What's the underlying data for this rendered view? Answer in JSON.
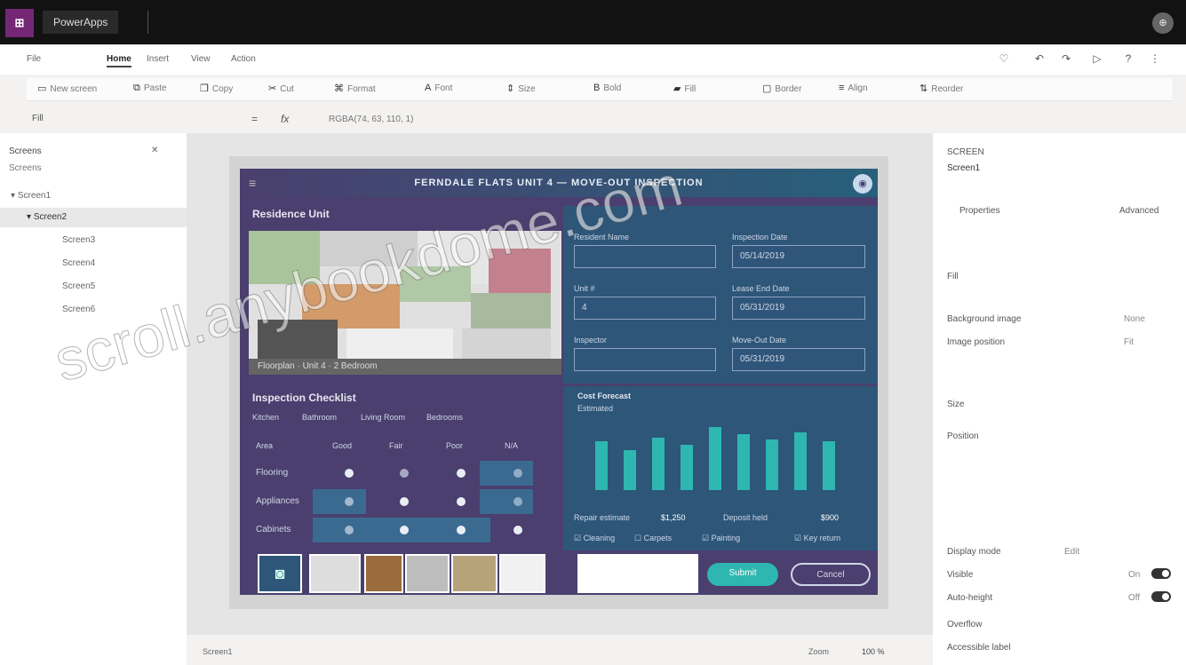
{
  "app": {
    "name": "PowerApps"
  },
  "titlebar": {
    "avatar_initial": "⊕"
  },
  "menubar": {
    "items": [
      "File",
      "Home",
      "Insert",
      "View",
      "Action"
    ],
    "active": "Home"
  },
  "ribbon": {
    "items": [
      {
        "icon": "new-screen-icon",
        "label": "New screen"
      },
      {
        "icon": "paste-icon",
        "label": "Paste"
      },
      {
        "icon": "copy-icon",
        "label": "Copy"
      },
      {
        "icon": "cut-icon",
        "label": "Cut"
      },
      {
        "icon": "format-painter-icon",
        "label": "Format"
      },
      {
        "icon": "font-icon",
        "label": "Font"
      },
      {
        "icon": "font-size-icon",
        "label": "Size"
      },
      {
        "icon": "bold-icon",
        "label": "Bold"
      },
      {
        "icon": "fill-icon",
        "label": "Fill"
      },
      {
        "icon": "border-icon",
        "label": "Border"
      },
      {
        "icon": "align-icon",
        "label": "Align"
      },
      {
        "icon": "reorder-icon",
        "label": "Reorder"
      }
    ]
  },
  "formula": {
    "property": "Fill",
    "eq": "=",
    "fx": "fx",
    "value": "RGBA(74, 63, 110, 1)"
  },
  "treeview": {
    "title": "Screens",
    "tab": "Screens",
    "items": [
      "Screen1",
      "Screen2",
      "Screen3",
      "Screen4",
      "Screen5",
      "Screen6"
    ]
  },
  "phone_app": {
    "header_title": "FERNDALE FLATS UNIT 4 — MOVE-OUT INSPECTION",
    "residence_title": "Residence Unit",
    "plan_caption": "Floorplan · Unit 4 · 2 Bedroom",
    "fields": [
      {
        "label": "Resident Name",
        "value": ""
      },
      {
        "label": "Inspection Date",
        "value": "05/14/2019"
      },
      {
        "label": "Unit #",
        "value": "4"
      },
      {
        "label": "Lease End Date",
        "value": "05/31/2019"
      },
      {
        "label": "Inspector",
        "value": ""
      },
      {
        "label": "Move-Out Date",
        "value": "05/31/2019"
      }
    ],
    "checklist_title": "Inspection Checklist",
    "checklist_tabs": [
      "Kitchen",
      "Bathroom",
      "Living Room",
      "Bedrooms"
    ],
    "checklist_columns": [
      "Area",
      "Good",
      "Fair",
      "Poor",
      "N/A"
    ],
    "checklist_rows": [
      "Flooring",
      "Appliances",
      "Cabinets"
    ],
    "chart_title": "Cost Forecast",
    "chart_subtitle": "Estimated",
    "repair_label": "Repair estimate",
    "repair_value": "$1,250",
    "deposit_label": "Deposit held",
    "deposit_value": "$900",
    "checkboxes": [
      "Cleaning",
      "Carpets",
      "Painting",
      "Key return"
    ],
    "submit": "Submit",
    "cancel": "Cancel"
  },
  "props": {
    "title": "SCREEN",
    "name": "Screen1",
    "tabs": [
      "Properties",
      "Advanced"
    ],
    "rows": [
      {
        "label": "Fill",
        "value": ""
      },
      {
        "label": "Background image",
        "value": "None"
      },
      {
        "label": "Image position",
        "value": "Fit"
      },
      {
        "label": "Size",
        "value": ""
      },
      {
        "label": "Position",
        "value": ""
      },
      {
        "label": "Visible",
        "value": "On"
      },
      {
        "label": "Auto-height",
        "value": "Off"
      },
      {
        "label": "Display mode",
        "value": "Edit"
      },
      {
        "label": "Overflow",
        "value": ""
      },
      {
        "label": "Accessible label",
        "value": ""
      }
    ]
  },
  "footer": {
    "screen": "Screen1",
    "zoom": "100 %",
    "zoom_label": "Zoom"
  },
  "watermark": "scroll.anybookdome.com",
  "colors": {
    "brand": "#742774",
    "app_purple": "#4a3f6e",
    "app_blue": "#2d5679",
    "teal": "#2db7b0"
  }
}
